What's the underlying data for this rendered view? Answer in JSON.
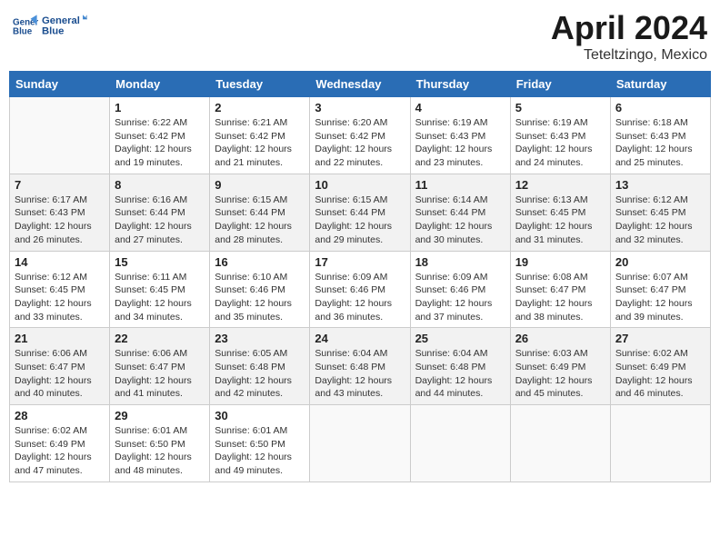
{
  "header": {
    "logo_line1": "General",
    "logo_line2": "Blue",
    "month_year": "April 2024",
    "location": "Teteltzingo, Mexico"
  },
  "weekdays": [
    "Sunday",
    "Monday",
    "Tuesday",
    "Wednesday",
    "Thursday",
    "Friday",
    "Saturday"
  ],
  "weeks": [
    [
      {
        "day": "",
        "info": ""
      },
      {
        "day": "1",
        "info": "Sunrise: 6:22 AM\nSunset: 6:42 PM\nDaylight: 12 hours\nand 19 minutes."
      },
      {
        "day": "2",
        "info": "Sunrise: 6:21 AM\nSunset: 6:42 PM\nDaylight: 12 hours\nand 21 minutes."
      },
      {
        "day": "3",
        "info": "Sunrise: 6:20 AM\nSunset: 6:42 PM\nDaylight: 12 hours\nand 22 minutes."
      },
      {
        "day": "4",
        "info": "Sunrise: 6:19 AM\nSunset: 6:43 PM\nDaylight: 12 hours\nand 23 minutes."
      },
      {
        "day": "5",
        "info": "Sunrise: 6:19 AM\nSunset: 6:43 PM\nDaylight: 12 hours\nand 24 minutes."
      },
      {
        "day": "6",
        "info": "Sunrise: 6:18 AM\nSunset: 6:43 PM\nDaylight: 12 hours\nand 25 minutes."
      }
    ],
    [
      {
        "day": "7",
        "info": "Sunrise: 6:17 AM\nSunset: 6:43 PM\nDaylight: 12 hours\nand 26 minutes."
      },
      {
        "day": "8",
        "info": "Sunrise: 6:16 AM\nSunset: 6:44 PM\nDaylight: 12 hours\nand 27 minutes."
      },
      {
        "day": "9",
        "info": "Sunrise: 6:15 AM\nSunset: 6:44 PM\nDaylight: 12 hours\nand 28 minutes."
      },
      {
        "day": "10",
        "info": "Sunrise: 6:15 AM\nSunset: 6:44 PM\nDaylight: 12 hours\nand 29 minutes."
      },
      {
        "day": "11",
        "info": "Sunrise: 6:14 AM\nSunset: 6:44 PM\nDaylight: 12 hours\nand 30 minutes."
      },
      {
        "day": "12",
        "info": "Sunrise: 6:13 AM\nSunset: 6:45 PM\nDaylight: 12 hours\nand 31 minutes."
      },
      {
        "day": "13",
        "info": "Sunrise: 6:12 AM\nSunset: 6:45 PM\nDaylight: 12 hours\nand 32 minutes."
      }
    ],
    [
      {
        "day": "14",
        "info": "Sunrise: 6:12 AM\nSunset: 6:45 PM\nDaylight: 12 hours\nand 33 minutes."
      },
      {
        "day": "15",
        "info": "Sunrise: 6:11 AM\nSunset: 6:45 PM\nDaylight: 12 hours\nand 34 minutes."
      },
      {
        "day": "16",
        "info": "Sunrise: 6:10 AM\nSunset: 6:46 PM\nDaylight: 12 hours\nand 35 minutes."
      },
      {
        "day": "17",
        "info": "Sunrise: 6:09 AM\nSunset: 6:46 PM\nDaylight: 12 hours\nand 36 minutes."
      },
      {
        "day": "18",
        "info": "Sunrise: 6:09 AM\nSunset: 6:46 PM\nDaylight: 12 hours\nand 37 minutes."
      },
      {
        "day": "19",
        "info": "Sunrise: 6:08 AM\nSunset: 6:47 PM\nDaylight: 12 hours\nand 38 minutes."
      },
      {
        "day": "20",
        "info": "Sunrise: 6:07 AM\nSunset: 6:47 PM\nDaylight: 12 hours\nand 39 minutes."
      }
    ],
    [
      {
        "day": "21",
        "info": "Sunrise: 6:06 AM\nSunset: 6:47 PM\nDaylight: 12 hours\nand 40 minutes."
      },
      {
        "day": "22",
        "info": "Sunrise: 6:06 AM\nSunset: 6:47 PM\nDaylight: 12 hours\nand 41 minutes."
      },
      {
        "day": "23",
        "info": "Sunrise: 6:05 AM\nSunset: 6:48 PM\nDaylight: 12 hours\nand 42 minutes."
      },
      {
        "day": "24",
        "info": "Sunrise: 6:04 AM\nSunset: 6:48 PM\nDaylight: 12 hours\nand 43 minutes."
      },
      {
        "day": "25",
        "info": "Sunrise: 6:04 AM\nSunset: 6:48 PM\nDaylight: 12 hours\nand 44 minutes."
      },
      {
        "day": "26",
        "info": "Sunrise: 6:03 AM\nSunset: 6:49 PM\nDaylight: 12 hours\nand 45 minutes."
      },
      {
        "day": "27",
        "info": "Sunrise: 6:02 AM\nSunset: 6:49 PM\nDaylight: 12 hours\nand 46 minutes."
      }
    ],
    [
      {
        "day": "28",
        "info": "Sunrise: 6:02 AM\nSunset: 6:49 PM\nDaylight: 12 hours\nand 47 minutes."
      },
      {
        "day": "29",
        "info": "Sunrise: 6:01 AM\nSunset: 6:50 PM\nDaylight: 12 hours\nand 48 minutes."
      },
      {
        "day": "30",
        "info": "Sunrise: 6:01 AM\nSunset: 6:50 PM\nDaylight: 12 hours\nand 49 minutes."
      },
      {
        "day": "",
        "info": ""
      },
      {
        "day": "",
        "info": ""
      },
      {
        "day": "",
        "info": ""
      },
      {
        "day": "",
        "info": ""
      }
    ]
  ]
}
